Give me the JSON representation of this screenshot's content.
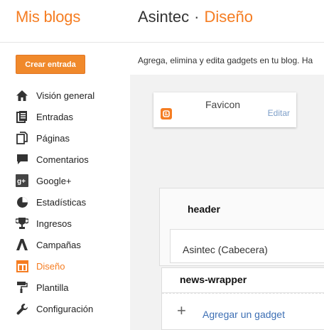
{
  "header": {
    "logo": "Mis blogs",
    "blog_name": "Asintec",
    "separator": "·",
    "section": "Diseño"
  },
  "sidebar": {
    "create_button": "Crear entrada",
    "items": [
      {
        "label": "Visión general",
        "icon": "home-icon"
      },
      {
        "label": "Entradas",
        "icon": "posts-icon"
      },
      {
        "label": "Páginas",
        "icon": "pages-icon"
      },
      {
        "label": "Comentarios",
        "icon": "comment-icon"
      },
      {
        "label": "Google+",
        "icon": "google-plus-icon"
      },
      {
        "label": "Estadísticas",
        "icon": "pie-chart-icon"
      },
      {
        "label": "Ingresos",
        "icon": "trophy-icon"
      },
      {
        "label": "Campañas",
        "icon": "campaign-icon"
      },
      {
        "label": "Diseño",
        "icon": "layout-icon",
        "active": true
      },
      {
        "label": "Plantilla",
        "icon": "paint-roller-icon"
      },
      {
        "label": "Configuración",
        "icon": "wrench-icon"
      }
    ]
  },
  "main": {
    "intro": "Agrega, elimina y edita gadgets en tu blog. Ha",
    "favicon": {
      "title": "Favicon",
      "edit": "Editar",
      "icon": "blogger-icon"
    },
    "header_section": {
      "label": "header",
      "widget": "Asintec (Cabecera)"
    },
    "news_section": {
      "label": "news-wrapper",
      "add_gadget": "Agregar un gadget",
      "plus": "+"
    }
  },
  "colors": {
    "accent": "#f57d22",
    "link": "#3d6fb4",
    "canvas": "#f2f2f2"
  }
}
